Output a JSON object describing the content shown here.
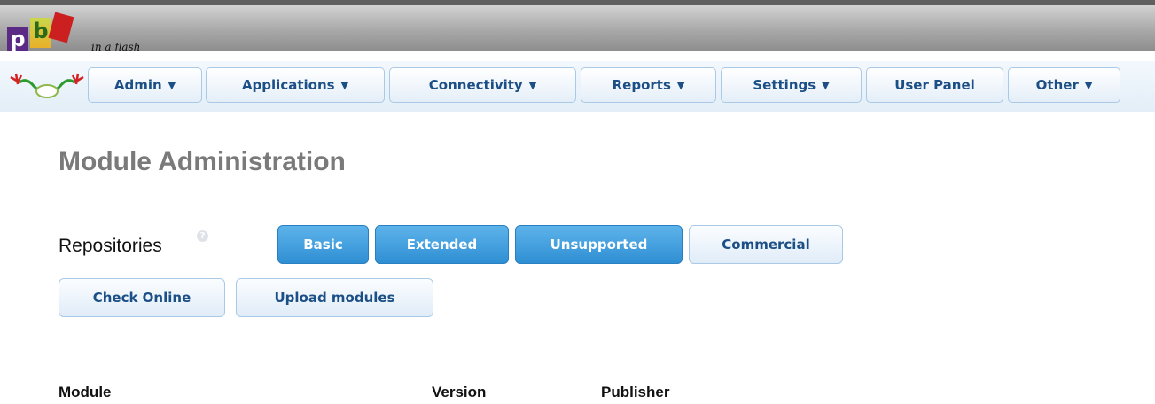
{
  "banner": {
    "logo_tagline": "in a flash"
  },
  "nav": {
    "items": [
      {
        "label": "Admin",
        "caret": "▼"
      },
      {
        "label": "Applications",
        "caret": "▼"
      },
      {
        "label": "Connectivity",
        "caret": "▼"
      },
      {
        "label": "Reports",
        "caret": "▼"
      },
      {
        "label": "Settings",
        "caret": "▼"
      },
      {
        "label": "User Panel",
        "caret": ""
      },
      {
        "label": "Other",
        "caret": "▼"
      }
    ]
  },
  "page": {
    "title": "Module Administration",
    "repositories_label": "Repositories",
    "help_icon": "?",
    "repo_buttons": [
      {
        "label": "Basic",
        "active": true
      },
      {
        "label": "Extended",
        "active": true
      },
      {
        "label": "Unsupported",
        "active": true
      },
      {
        "label": "Commercial",
        "active": false
      }
    ],
    "actions": {
      "check_online": "Check Online",
      "upload_modules": "Upload modules"
    },
    "table": {
      "columns": [
        "Module",
        "Version",
        "Publisher"
      ]
    }
  },
  "colors": {
    "accent": "#3a9adb",
    "nav_text": "#1b4f86",
    "title_gray": "#7a7a7a"
  },
  "icons": [
    "frog-logo-icon",
    "caret-down-icon",
    "help-icon"
  ]
}
